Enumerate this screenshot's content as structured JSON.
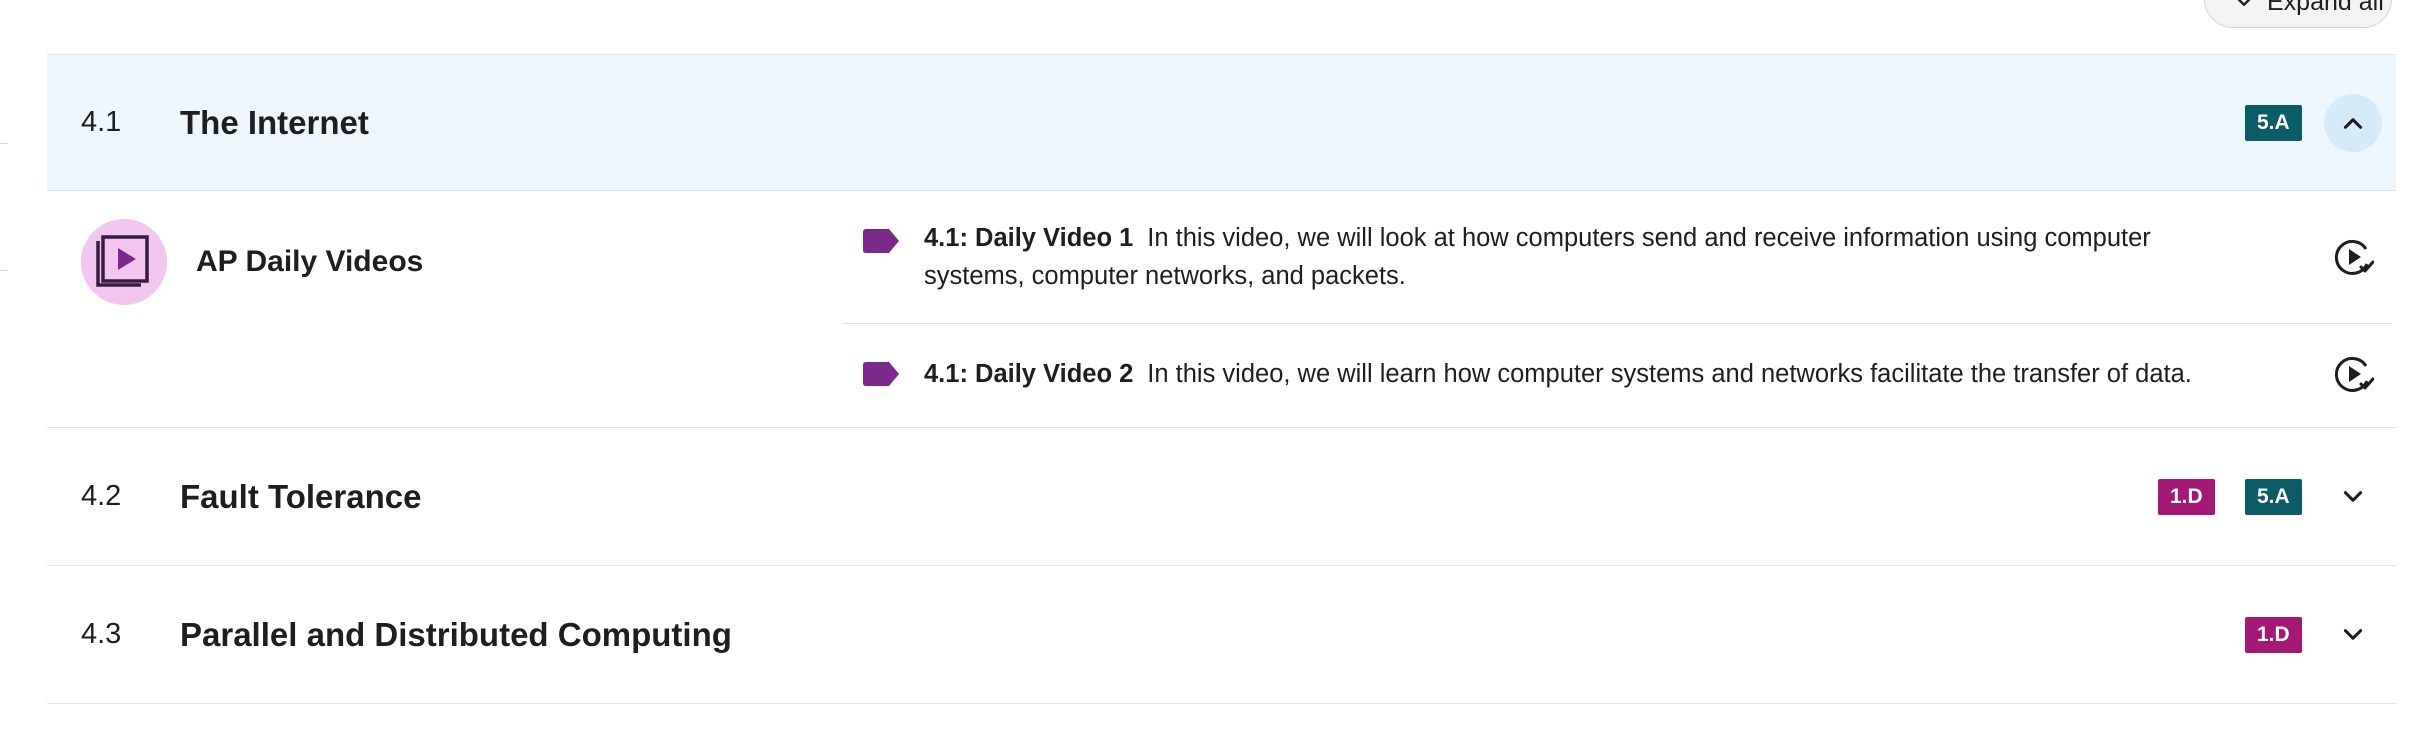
{
  "toolbar": {
    "expand_all_label": "Expand all"
  },
  "units": [
    {
      "number": "4.1",
      "title": "The Internet",
      "expanded": true,
      "badges": [
        {
          "label": "5.A",
          "color": "#0b5c69"
        }
      ],
      "content": {
        "category": "AP Daily Videos",
        "category_icon": "video-library-icon",
        "videos": [
          {
            "title": "4.1: Daily Video 1",
            "description": "In this video, we will look at how computers send and receive information using computer systems, computer networks, and packets."
          },
          {
            "title": "4.1: Daily Video 2",
            "description": "In this video, we will learn how computer systems and networks facilitate the transfer of data."
          }
        ]
      }
    },
    {
      "number": "4.2",
      "title": "Fault Tolerance",
      "expanded": false,
      "badges": [
        {
          "label": "1.D",
          "color": "#a41877"
        },
        {
          "label": "5.A",
          "color": "#0b5c69"
        }
      ]
    },
    {
      "number": "4.3",
      "title": "Parallel and Distributed Computing",
      "expanded": false,
      "badges": [
        {
          "label": "1.D",
          "color": "#a41877"
        }
      ]
    }
  ],
  "colors": {
    "accent_purple": "#7b2a8c",
    "open_header_bg": "#eef6fd",
    "toggle_bg": "#d4ebfa",
    "badge_teal": "#0b5c69",
    "badge_magenta": "#a41877"
  }
}
